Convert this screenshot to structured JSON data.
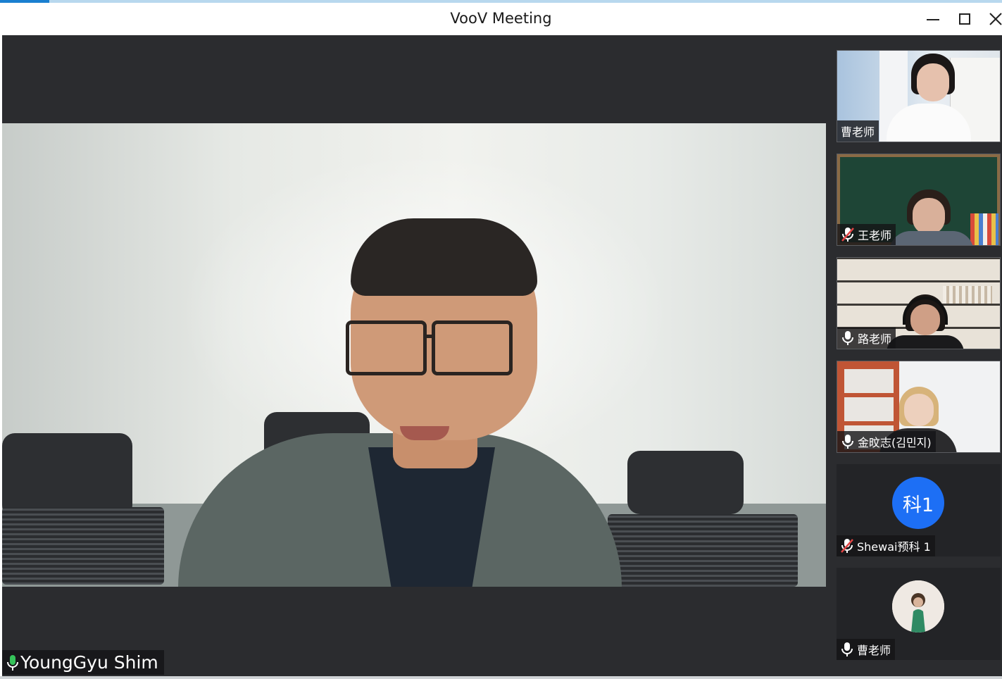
{
  "window": {
    "title": "VooV Meeting",
    "minimize_icon": "minimize-icon",
    "maximize_icon": "maximize-icon",
    "close_icon": "close-icon"
  },
  "main_speaker": {
    "name": "YoungGyu Shim",
    "mic_state": "on"
  },
  "participants": [
    {
      "name": "曹老师",
      "video": true,
      "mic_state": "none"
    },
    {
      "name": "王老师",
      "video": true,
      "mic_state": "muted"
    },
    {
      "name": "路老师",
      "video": true,
      "mic_state": "on"
    },
    {
      "name": "金旼志(김민지)",
      "video": true,
      "mic_state": "on"
    },
    {
      "name": "Shewai预科 1",
      "video": false,
      "avatar_text": "科1",
      "avatar_color": "#1d6ff5",
      "mic_state": "muted"
    },
    {
      "name": "曹老师",
      "video": false,
      "avatar_type": "photo",
      "mic_state": "on"
    }
  ],
  "colors": {
    "stage_bg": "#2b2c2f",
    "name_tag_bg": "#141416",
    "mic_active": "#35c35a",
    "mic_muted": "#e04444"
  }
}
